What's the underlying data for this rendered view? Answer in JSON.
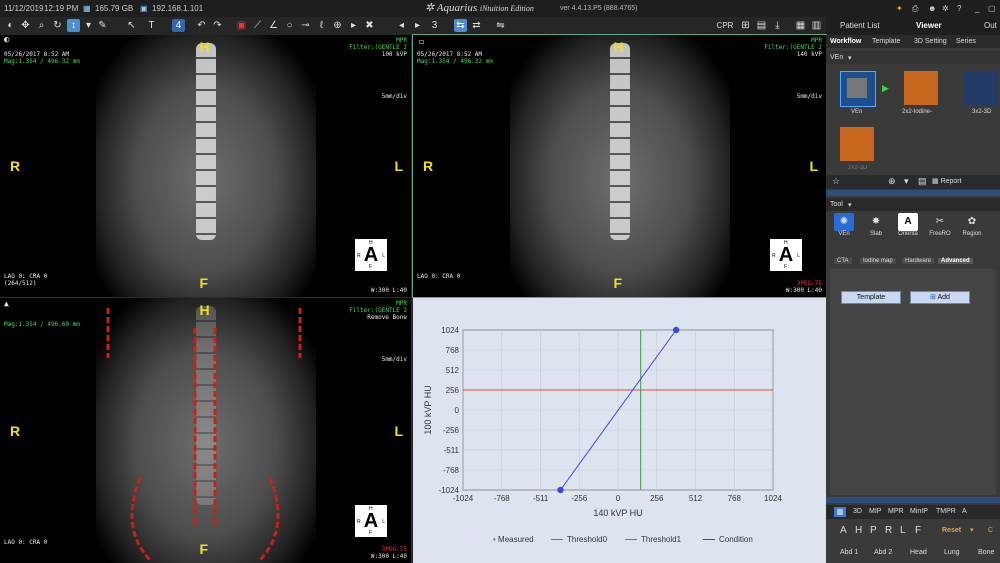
{
  "status": {
    "date": "11/12/2019",
    "time": "12:19 PM",
    "disk": "165.79 GB",
    "ip": "192.168.1.101",
    "close": "Close"
  },
  "brand": {
    "name": "Aquarius",
    "edition": "iNtuition Edition",
    "version": "ver 4.4.13.P5 (888.4765)"
  },
  "toolbar": {
    "layout_count": "4",
    "page_number": "3",
    "cpr_label": "CPR"
  },
  "right_tabs": {
    "patient_list": "Patient List",
    "viewer": "Viewer",
    "out": "Out"
  },
  "viewports": [
    {
      "date": "05/26/2017 8:52 AM",
      "mag": "Mag:1.354 / 496.32 mm",
      "mpr": "MPR",
      "filter": "Filter:(GENTLE 2",
      "info": "100 kVP",
      "scale": "5mm/div",
      "lao": "LAO 0: CRA 0",
      "size": "(264/512)",
      "wl": "W:300 L:40",
      "tag": "",
      "top": "H",
      "bottom": "F",
      "left": "R",
      "right": "L"
    },
    {
      "date": "05/26/2017 8:52 AM",
      "mag": "Mag:1.354 / 496.32 mm",
      "mpr": "MPR",
      "filter": "Filter:(GENTLE 2",
      "info": "140 kVP",
      "scale": "5mm/div",
      "lao": "LAO 0: CRA 0",
      "size": "",
      "wl": "W:300 L:40",
      "tag": "3PEG:75",
      "top": "H",
      "bottom": "F",
      "left": "R",
      "right": "L"
    },
    {
      "date": "",
      "mag": "Mag:1.354 / 496.60 mm",
      "mpr": "MPR",
      "filter": "Filter:(GENTLE 2",
      "info": "Remove Bone",
      "scale": "5mm/div",
      "lao": "LAO 0: CRA 0",
      "size": "",
      "wl": "W:300 L:40",
      "tag": "3PEG:75",
      "top": "H",
      "bottom": "F",
      "left": "R",
      "right": "L"
    }
  ],
  "cube": {
    "letter": "A",
    "top": "H",
    "bottom": "F",
    "left": "R",
    "right": "L"
  },
  "chart_data": {
    "type": "line",
    "xlabel": "140 kVP HU",
    "ylabel": "100 kVP HU",
    "xlim": [
      -1024,
      1024
    ],
    "ylim": [
      -1024,
      1024
    ],
    "xticks": [
      "-1024",
      "-768",
      "-511",
      "-256",
      "0",
      "256",
      "512",
      "768",
      "1024"
    ],
    "yticks": [
      "1024",
      "768",
      "512",
      "256",
      "0",
      "-256",
      "-511",
      "-768",
      "-1024"
    ],
    "threshold0_x": 150,
    "threshold1_y": 256,
    "condition": {
      "x": [
        -380,
        384
      ],
      "y": [
        -1024,
        1024
      ]
    },
    "legend": [
      "Measured",
      "Threshold0",
      "Threshold1",
      "Condition"
    ],
    "colors": {
      "Measured": "#2e8b3a",
      "Threshold0": "#3c9a3c",
      "Threshold1": "#e24a3a",
      "Condition": "#3a4ae0"
    },
    "grid": true
  },
  "panel": {
    "tabs": [
      "Workflow",
      "Template",
      "3D Setting",
      "Series"
    ],
    "workflow_header": "VEn",
    "thumbs": [
      "VEn",
      "2x2-Iodine-",
      "3x2-3D",
      "2x2-3D"
    ],
    "report": "Report",
    "tool_header": "Tool",
    "tools": [
      "VEn",
      "Slab",
      "Orienta",
      "FreeRO",
      "Region"
    ],
    "subtabs": [
      "CTA",
      "Iodine map",
      "Hardware",
      "Advanced"
    ],
    "template_btn": "Template",
    "add_btn": "Add",
    "modes": [
      "3D",
      "MIP",
      "MPR",
      "MinIP",
      "TMPR",
      "A"
    ],
    "orient": [
      "A",
      "H",
      "P",
      "R",
      "L",
      "F"
    ],
    "reset": "Reset",
    "presets": [
      "Abd 1",
      "Abd 2",
      "Head",
      "Lung",
      "Bone"
    ]
  }
}
